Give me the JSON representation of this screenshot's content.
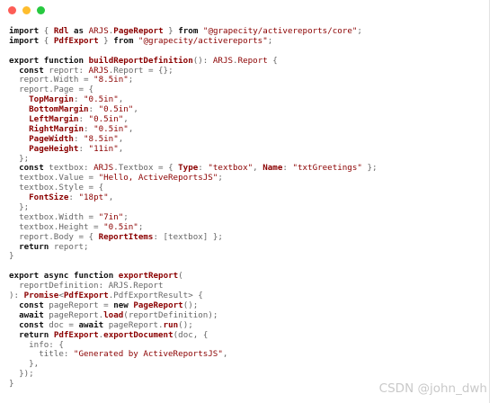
{
  "window": {
    "controls": [
      "close",
      "minimize",
      "maximize"
    ]
  },
  "code_lines": [
    [
      [
        "kw",
        "import"
      ],
      [
        "pl",
        " { "
      ],
      [
        "fn",
        "Rdl"
      ],
      [
        "pl",
        " "
      ],
      [
        "kw",
        "as"
      ],
      [
        "pl",
        " "
      ],
      [
        "ty",
        "ARJS"
      ],
      [
        "pl",
        "."
      ],
      [
        "fn",
        "PageReport"
      ],
      [
        "pl",
        " } "
      ],
      [
        "kw",
        "from"
      ],
      [
        "pl",
        " "
      ],
      [
        "str",
        "\"@grapecity/activereports/core\""
      ],
      [
        "pl",
        ";"
      ]
    ],
    [
      [
        "kw",
        "import"
      ],
      [
        "pl",
        " { "
      ],
      [
        "fn",
        "PdfExport"
      ],
      [
        "pl",
        " } "
      ],
      [
        "kw",
        "from"
      ],
      [
        "pl",
        " "
      ],
      [
        "str",
        "\"@grapecity/activereports\""
      ],
      [
        "pl",
        ";"
      ]
    ],
    [],
    [
      [
        "kw",
        "export"
      ],
      [
        "pl",
        " "
      ],
      [
        "kw",
        "function"
      ],
      [
        "pl",
        " "
      ],
      [
        "fn",
        "buildReportDefinition"
      ],
      [
        "pl",
        "(): "
      ],
      [
        "ty",
        "ARJS"
      ],
      [
        "pl",
        "."
      ],
      [
        "ty",
        "Report"
      ],
      [
        "pl",
        " {"
      ]
    ],
    [
      [
        "pl",
        "  "
      ],
      [
        "kw",
        "const"
      ],
      [
        "pl",
        " report: "
      ],
      [
        "ty",
        "ARJS"
      ],
      [
        "pl",
        ".Report = {};"
      ]
    ],
    [
      [
        "pl",
        "  report.Width = "
      ],
      [
        "str",
        "\"8.5in\""
      ],
      [
        "pl",
        ";"
      ]
    ],
    [
      [
        "pl",
        "  report.Page = {"
      ]
    ],
    [
      [
        "pl",
        "    "
      ],
      [
        "fn",
        "TopMargin"
      ],
      [
        "pl",
        ": "
      ],
      [
        "str",
        "\"0.5in\""
      ],
      [
        "pl",
        ","
      ]
    ],
    [
      [
        "pl",
        "    "
      ],
      [
        "fn",
        "BottomMargin"
      ],
      [
        "pl",
        ": "
      ],
      [
        "str",
        "\"0.5in\""
      ],
      [
        "pl",
        ","
      ]
    ],
    [
      [
        "pl",
        "    "
      ],
      [
        "fn",
        "LeftMargin"
      ],
      [
        "pl",
        ": "
      ],
      [
        "str",
        "\"0.5in\""
      ],
      [
        "pl",
        ","
      ]
    ],
    [
      [
        "pl",
        "    "
      ],
      [
        "fn",
        "RightMargin"
      ],
      [
        "pl",
        ": "
      ],
      [
        "str",
        "\"0.5in\""
      ],
      [
        "pl",
        ","
      ]
    ],
    [
      [
        "pl",
        "    "
      ],
      [
        "fn",
        "PageWidth"
      ],
      [
        "pl",
        ": "
      ],
      [
        "str",
        "\"8.5in\""
      ],
      [
        "pl",
        ","
      ]
    ],
    [
      [
        "pl",
        "    "
      ],
      [
        "fn",
        "PageHeight"
      ],
      [
        "pl",
        ": "
      ],
      [
        "str",
        "\"11in\""
      ],
      [
        "pl",
        ","
      ]
    ],
    [
      [
        "pl",
        "  };"
      ]
    ],
    [
      [
        "pl",
        "  "
      ],
      [
        "kw",
        "const"
      ],
      [
        "pl",
        " textbox: "
      ],
      [
        "ty",
        "ARJS"
      ],
      [
        "pl",
        ".Textbox = { "
      ],
      [
        "fn",
        "Type"
      ],
      [
        "pl",
        ": "
      ],
      [
        "str",
        "\"textbox\""
      ],
      [
        "pl",
        ", "
      ],
      [
        "fn",
        "Name"
      ],
      [
        "pl",
        ": "
      ],
      [
        "str",
        "\"txtGreetings\""
      ],
      [
        "pl",
        " };"
      ]
    ],
    [
      [
        "pl",
        "  textbox.Value = "
      ],
      [
        "str",
        "\"Hello, ActiveReportsJS\""
      ],
      [
        "pl",
        ";"
      ]
    ],
    [
      [
        "pl",
        "  textbox.Style = {"
      ]
    ],
    [
      [
        "pl",
        "    "
      ],
      [
        "fn",
        "FontSize"
      ],
      [
        "pl",
        ": "
      ],
      [
        "str",
        "\"18pt\""
      ],
      [
        "pl",
        ","
      ]
    ],
    [
      [
        "pl",
        "  };"
      ]
    ],
    [
      [
        "pl",
        "  textbox.Width = "
      ],
      [
        "str",
        "\"7in\""
      ],
      [
        "pl",
        ";"
      ]
    ],
    [
      [
        "pl",
        "  textbox.Height = "
      ],
      [
        "str",
        "\"0.5in\""
      ],
      [
        "pl",
        ";"
      ]
    ],
    [
      [
        "pl",
        "  report.Body = { "
      ],
      [
        "fn",
        "ReportItems"
      ],
      [
        "pl",
        ": [textbox] };"
      ]
    ],
    [
      [
        "pl",
        "  "
      ],
      [
        "kw",
        "return"
      ],
      [
        "pl",
        " report;"
      ]
    ],
    [
      [
        "pl",
        "}"
      ]
    ],
    [],
    [
      [
        "kw",
        "export"
      ],
      [
        "pl",
        " "
      ],
      [
        "kw",
        "async"
      ],
      [
        "pl",
        " "
      ],
      [
        "kw",
        "function"
      ],
      [
        "pl",
        " "
      ],
      [
        "fn",
        "exportReport"
      ],
      [
        "pl",
        "("
      ]
    ],
    [
      [
        "pl",
        "  reportDefinition: ARJS.Report"
      ]
    ],
    [
      [
        "pl",
        "): "
      ],
      [
        "fn",
        "Promise"
      ],
      [
        "pl",
        "<"
      ],
      [
        "fn",
        "PdfExport"
      ],
      [
        "pl",
        ".PdfExportResult> {"
      ]
    ],
    [
      [
        "pl",
        "  "
      ],
      [
        "kw",
        "const"
      ],
      [
        "pl",
        " pageReport = "
      ],
      [
        "kw",
        "new"
      ],
      [
        "pl",
        " "
      ],
      [
        "fn",
        "PageReport"
      ],
      [
        "pl",
        "();"
      ]
    ],
    [
      [
        "pl",
        "  "
      ],
      [
        "kw",
        "await"
      ],
      [
        "pl",
        " pageReport."
      ],
      [
        "fn",
        "load"
      ],
      [
        "pl",
        "(reportDefinition);"
      ]
    ],
    [
      [
        "pl",
        "  "
      ],
      [
        "kw",
        "const"
      ],
      [
        "pl",
        " doc = "
      ],
      [
        "kw",
        "await"
      ],
      [
        "pl",
        " pageReport."
      ],
      [
        "fn",
        "run"
      ],
      [
        "pl",
        "();"
      ]
    ],
    [
      [
        "pl",
        "  "
      ],
      [
        "kw",
        "return"
      ],
      [
        "pl",
        " "
      ],
      [
        "fn",
        "PdfExport"
      ],
      [
        "pl",
        "."
      ],
      [
        "fn",
        "exportDocument"
      ],
      [
        "pl",
        "(doc, {"
      ]
    ],
    [
      [
        "pl",
        "    info: {"
      ]
    ],
    [
      [
        "pl",
        "      title: "
      ],
      [
        "str",
        "\"Generated by ActiveReportsJS\""
      ],
      [
        "pl",
        ","
      ]
    ],
    [
      [
        "pl",
        "    },"
      ]
    ],
    [
      [
        "pl",
        "  });"
      ]
    ],
    [
      [
        "pl",
        "}"
      ]
    ]
  ],
  "watermark": "CSDN @john_dwh"
}
